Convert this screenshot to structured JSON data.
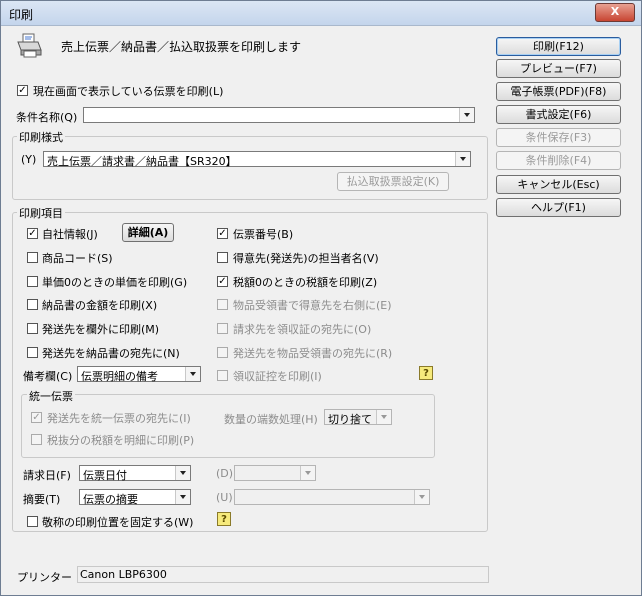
{
  "window": {
    "title": "印刷",
    "close_label": "X"
  },
  "header": {
    "description": "売上伝票／納品書／払込取扱票を印刷します"
  },
  "current_screen_print": {
    "label": "現在画面で表示している伝票を印刷(L)",
    "checked": true
  },
  "condition": {
    "label": "条件名称(Q)",
    "value": ""
  },
  "print_style": {
    "group_label": "印刷様式",
    "prefix": "(Y)",
    "value": "売上伝票／請求書／納品書【SR320】",
    "furikomi_button": "払込取扱票設定(K)"
  },
  "print_items": {
    "group_label": "印刷項目",
    "company_info": "自社情報(J)",
    "detail_button": "詳細(A)",
    "slip_number": "伝票番号(B)",
    "product_code": "商品コード(S)",
    "contact_person": "得意先(発送先)の担当者名(V)",
    "unit_price_zero": "単価0のときの単価を印刷(G)",
    "tax_zero": "税額0のときの税額を印刷(Z)",
    "delivery_amount": "納品書の金額を印刷(X)",
    "receipt_right": "物品受領書で得意先を右側に(E)",
    "ship_outside": "発送先を欄外に印刷(M)",
    "bill_receipt_addr": "請求先を領収証の宛先に(O)",
    "ship_delivery_addr": "発送先を納品書の宛先に(N)",
    "ship_receipt_addr": "発送先を物品受領書の宛先に(R)",
    "notes_label": "備考欄(C)",
    "notes_value": "伝票明細の備考",
    "receipt_stamp": "領収証控を印刷(I)"
  },
  "unified": {
    "group_label": "統一伝票",
    "ship_to_addr": "発送先を統一伝票の宛先に(I)",
    "fraction_label": "数量の端数処理(H)",
    "fraction_value": "切り捨て",
    "tax_excluded": "税抜分の税額を明細に印刷(P)"
  },
  "bottom": {
    "billing_date_label": "請求日(F)",
    "billing_date_value": "伝票日付",
    "d_label": "(D)",
    "summary_label": "摘要(T)",
    "summary_value": "伝票の摘要",
    "u_label": "(U)",
    "honorific_fixed": "敬称の印刷位置を固定する(W)"
  },
  "printer": {
    "label": "プリンター",
    "value": "Canon LBP6300"
  },
  "buttons": {
    "print": "印刷(F12)",
    "preview": "プレビュー(F7)",
    "pdf": "電子帳票(PDF)(F8)",
    "format": "書式設定(F6)",
    "save_cond": "条件保存(F3)",
    "delete_cond": "条件削除(F4)",
    "cancel": "キャンセル(Esc)",
    "help": "ヘルプ(F1)"
  },
  "icons": {
    "printer": "printer-icon",
    "help": "help-icon"
  }
}
